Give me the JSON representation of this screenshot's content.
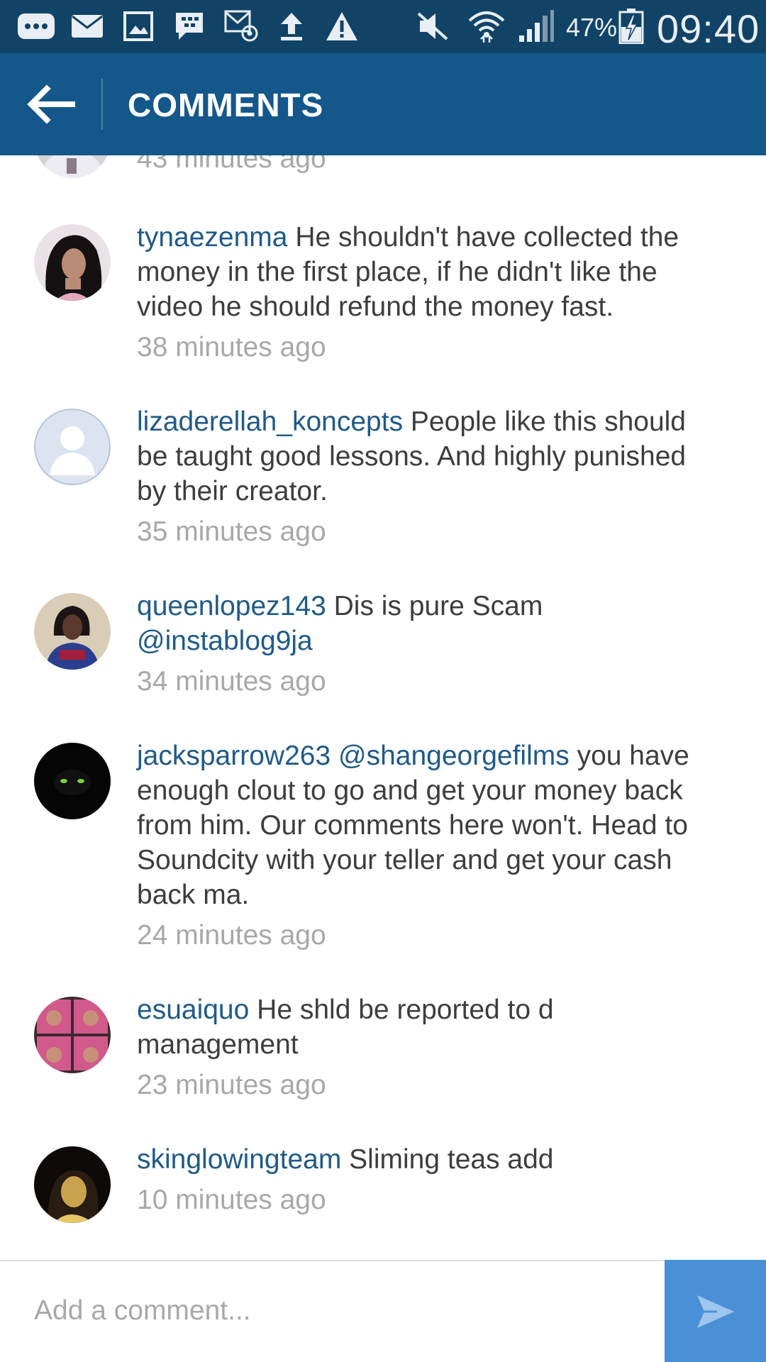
{
  "status_bar": {
    "battery_percent": "47%",
    "time": "09:40",
    "icons": [
      "more-icon",
      "mail-icon",
      "image-icon",
      "bbm-icon",
      "email-notification-icon",
      "upload-icon",
      "warning-icon",
      "mute-icon",
      "wifi-icon",
      "signal-icon",
      "battery-charging-icon"
    ]
  },
  "action_bar": {
    "title": "COMMENTS",
    "back_icon": "arrow-left-icon"
  },
  "comments": [
    {
      "timestamp": "43 minutes ago"
    },
    {
      "username": "tynaezenma",
      "text": "He shouldn't have collected the money in the first place, if he didn't like the video he should refund the money fast.",
      "timestamp": "38 minutes ago"
    },
    {
      "username": "lizaderellah_koncepts",
      "text": "People like this should be taught good lessons. And highly punished by their creator.",
      "timestamp": "35 minutes ago"
    },
    {
      "username": "queenlopez143",
      "text": "Dis is pure Scam",
      "mention": "@instablog9ja",
      "timestamp": "34 minutes ago"
    },
    {
      "username": "jacksparrow263",
      "mention": "@shangeorgefilms",
      "text": "you have enough clout to go and get your money back from him. Our comments here won't. Head to Soundcity with your teller and get your cash back ma.",
      "timestamp": "24 minutes ago"
    },
    {
      "username": "esuaiquo",
      "text": "He shld be reported to d management",
      "timestamp": "23 minutes ago"
    },
    {
      "username": "skinglowingteam",
      "text": "Sliming teas add",
      "timestamp": "10 minutes ago"
    }
  ],
  "composer": {
    "placeholder": "Add a comment...",
    "send_icon": "send-icon"
  },
  "colors": {
    "status_bar": "#114366",
    "action_bar": "#14578a",
    "username": "#1f5a88",
    "timestamp": "#a8a8a8",
    "send_button": "#4a90d6"
  }
}
